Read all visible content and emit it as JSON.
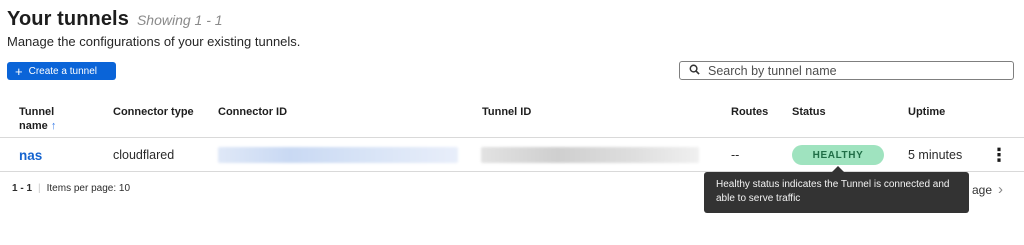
{
  "header": {
    "title": "Your tunnels",
    "showing": "Showing 1 - 1",
    "subtitle": "Manage the configurations of your existing tunnels."
  },
  "toolbar": {
    "create_label": "Create a tunnel",
    "search_placeholder": "Search by tunnel name"
  },
  "table": {
    "columns": {
      "tunnel_name": "Tunnel",
      "tunnel_name_2": "name",
      "connector_type": "Connector type",
      "connector_id": "Connector ID",
      "tunnel_id": "Tunnel ID",
      "routes": "Routes",
      "status": "Status",
      "uptime": "Uptime"
    },
    "rows": [
      {
        "name": "nas",
        "connector_type": "cloudflared",
        "routes": "--",
        "status": "HEALTHY",
        "uptime": "5 minutes"
      }
    ]
  },
  "footer": {
    "range": "1 - 1",
    "items_per_page": "Items per page: 10",
    "page_partial": "age"
  },
  "tooltip": {
    "text": "Healthy status indicates the Tunnel is connected and able to serve traffic"
  },
  "colors": {
    "accent": "#0a64d8",
    "link": "#1664cf",
    "status_healthy_bg": "#9fe3bf",
    "status_healthy_text": "#1f6e46",
    "tooltip_bg": "#333333"
  }
}
